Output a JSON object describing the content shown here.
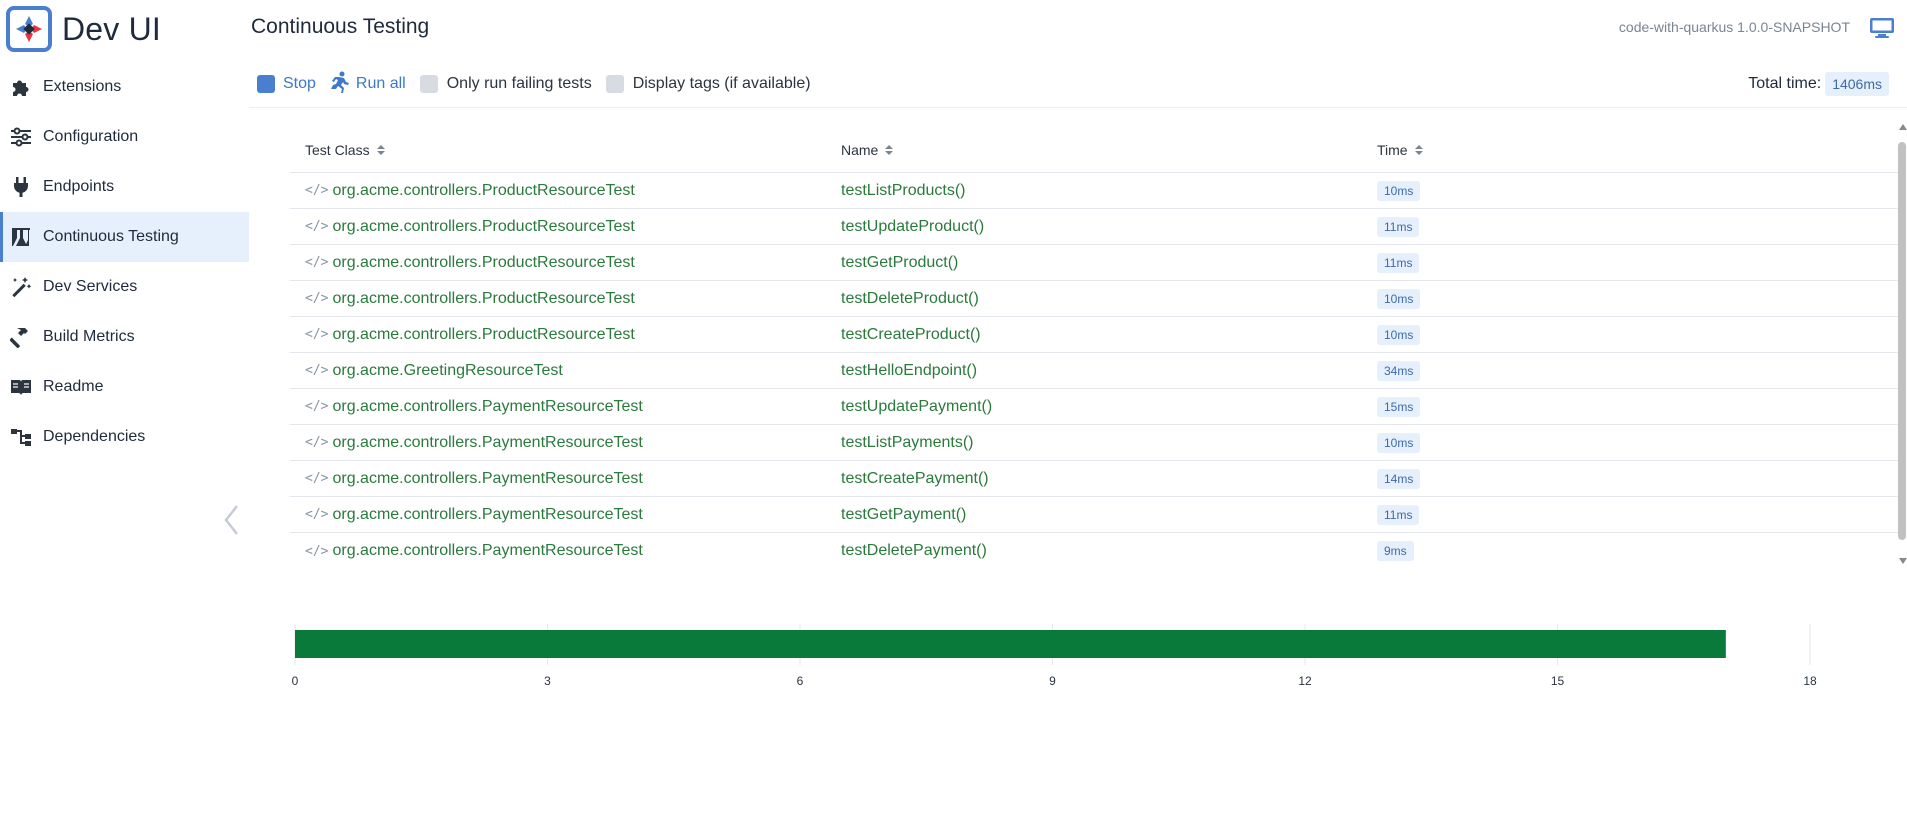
{
  "brand": {
    "title": "Dev UI"
  },
  "sidebar": {
    "items": [
      {
        "label": "Extensions",
        "icon": "puzzle-icon",
        "active": false
      },
      {
        "label": "Configuration",
        "icon": "sliders-icon",
        "active": false
      },
      {
        "label": "Endpoints",
        "icon": "plug-icon",
        "active": false
      },
      {
        "label": "Continuous Testing",
        "icon": "flask-icon",
        "active": true
      },
      {
        "label": "Dev Services",
        "icon": "magic-wand-icon",
        "active": false
      },
      {
        "label": "Build Metrics",
        "icon": "hammer-icon",
        "active": false
      },
      {
        "label": "Readme",
        "icon": "book-icon",
        "active": false
      },
      {
        "label": "Dependencies",
        "icon": "tree-icon",
        "active": false
      }
    ]
  },
  "header": {
    "title": "Continuous Testing",
    "app_version": "code-with-quarkus 1.0.0-SNAPSHOT"
  },
  "toolbar": {
    "stop_label": "Stop",
    "run_all_label": "Run all",
    "failing_only_label": "Only run failing tests",
    "display_tags_label": "Display tags (if available)",
    "total_time_label": "Total time:",
    "total_time_value": "1406ms"
  },
  "table": {
    "columns": [
      "Test Class",
      "Name",
      "Time"
    ],
    "rows": [
      {
        "test_class": "org.acme.controllers.ProductResourceTest",
        "name": "testListProducts()",
        "time": "10ms"
      },
      {
        "test_class": "org.acme.controllers.ProductResourceTest",
        "name": "testUpdateProduct()",
        "time": "11ms"
      },
      {
        "test_class": "org.acme.controllers.ProductResourceTest",
        "name": "testGetProduct()",
        "time": "11ms"
      },
      {
        "test_class": "org.acme.controllers.ProductResourceTest",
        "name": "testDeleteProduct()",
        "time": "10ms"
      },
      {
        "test_class": "org.acme.controllers.ProductResourceTest",
        "name": "testCreateProduct()",
        "time": "10ms"
      },
      {
        "test_class": "org.acme.GreetingResourceTest",
        "name": "testHelloEndpoint()",
        "time": "34ms"
      },
      {
        "test_class": "org.acme.controllers.PaymentResourceTest",
        "name": "testUpdatePayment()",
        "time": "15ms"
      },
      {
        "test_class": "org.acme.controllers.PaymentResourceTest",
        "name": "testListPayments()",
        "time": "10ms"
      },
      {
        "test_class": "org.acme.controllers.PaymentResourceTest",
        "name": "testCreatePayment()",
        "time": "14ms"
      },
      {
        "test_class": "org.acme.controllers.PaymentResourceTest",
        "name": "testGetPayment()",
        "time": "11ms"
      },
      {
        "test_class": "org.acme.controllers.PaymentResourceTest",
        "name": "testDeletePayment()",
        "time": "9ms"
      }
    ]
  },
  "chart_data": {
    "type": "bar",
    "orientation": "horizontal",
    "categories": [
      ""
    ],
    "values": [
      17
    ],
    "xlim": [
      0,
      18
    ],
    "xticks": [
      "0",
      "3",
      "6",
      "9",
      "12",
      "15",
      "18"
    ],
    "bar_color": "#0a7a3a",
    "grid": true
  },
  "colors": {
    "accent": "#4a7fd0",
    "link_green": "#2a7a3c",
    "bar_green": "#0a7a3a",
    "badge_bg": "#e6effc"
  }
}
